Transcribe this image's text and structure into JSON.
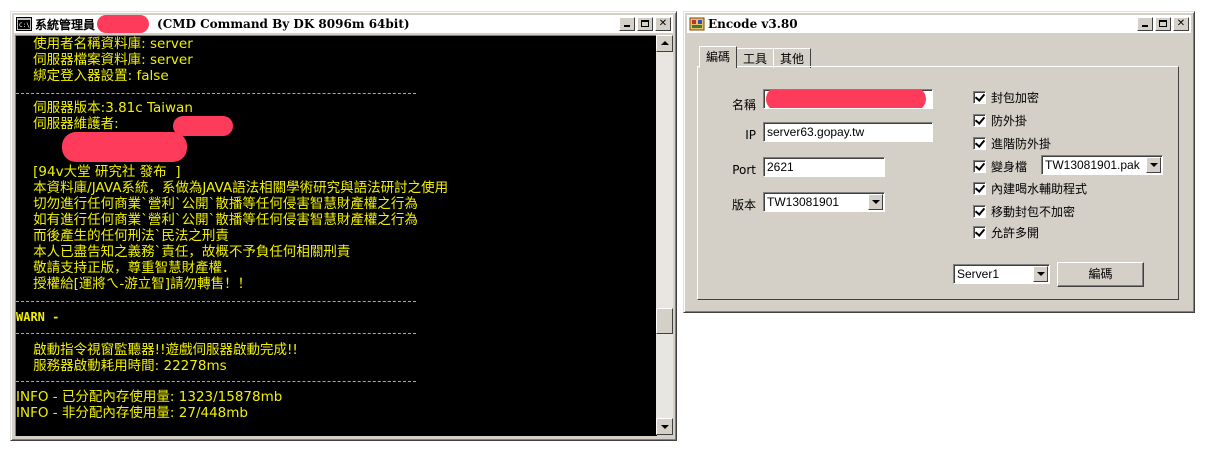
{
  "cmd_window": {
    "title_prefix": "系統管理員",
    "title_suffix": "(CMD Command By DK 8096m 64bit)",
    "lines": {
      "l1": "    使用者名稱資料庫: server",
      "l2": "    伺服器檔案資料庫: server",
      "l3": "    綁定登入器設置: false",
      "l4": "    伺服器版本:3.81c Taiwan",
      "l5": "    伺服器維護者:",
      "l6": "    [94v大堂 研究社 發布  ]",
      "l7": "    本資料庫/JAVA系統，系做為JAVA語法相關學術研究與語法研討之使用",
      "l8": "    切勿進行任何商業`營利`公開`散播等任何侵害智慧財產權之行為",
      "l9": "    如有進行任何商業`營利`公開`散播等任何侵害智慧財產權之行為",
      "l10": "    而後產生的任何刑法`民法之刑責",
      "l11": "    本人已盡告知之義務`責任，故概不予負任何相關刑責",
      "l12": "    敬請支持正版，尊重智慧財產權．",
      "l13": "    授權給[運將ㄟ-游立智]請勿轉售！！",
      "warn": "WARN -",
      "l14": "    啟動指令視窗監聽器!!遊戲伺服器啟動完成!!",
      "l15": "    服務器啟動耗用時間: 22278ms",
      "info1": "INFO - 已分配內存使用量: 1323/15878mb",
      "info2": "INFO - 非分配內存使用量: 27/448mb"
    }
  },
  "encode_window": {
    "title": "Encode v3.80",
    "tabs": [
      "編碼",
      "工具",
      "其他"
    ],
    "name_label": "名稱",
    "ip_label": "IP",
    "ip_value": "server63.gopay.tw",
    "port_label": "Port",
    "port_value": "2621",
    "version_label": "版本",
    "version_value": "TW13081901",
    "checkboxes": {
      "c1": "封包加密",
      "c2": "防外掛",
      "c3": "進階防外掛",
      "c4": "變身檔",
      "c5": "內建喝水輔助程式",
      "c6": "移動封包不加密",
      "c7": "允許多開"
    },
    "pak_value": "TW13081901.pak",
    "server_value": "Server1",
    "encode_button": "編碼"
  },
  "colors": {
    "console_text": "#f0f000",
    "console_bg": "#000000",
    "redaction": "#ff3b5c",
    "window_face": "#d4d0c8"
  }
}
